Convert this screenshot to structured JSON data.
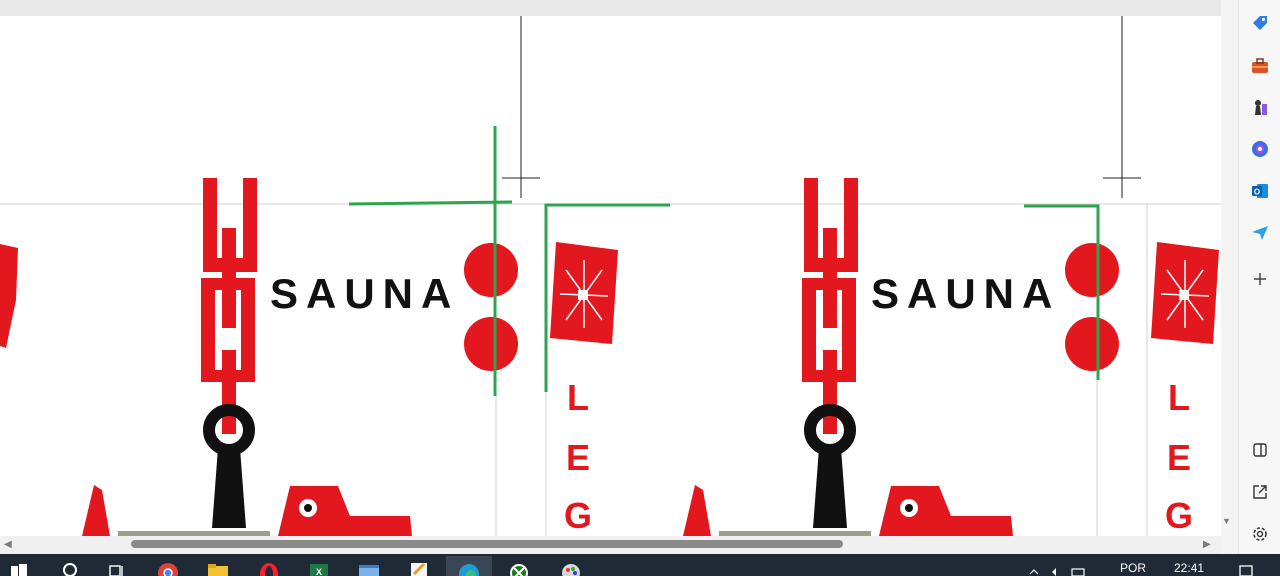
{
  "document": {
    "pages": [
      {
        "title": "SAUNA",
        "side_letters": [
          "L",
          "E",
          "G"
        ]
      },
      {
        "title": "SAUNA",
        "side_letters": [
          "L",
          "E",
          "G"
        ]
      }
    ]
  },
  "scrollbar": {
    "left_arrow": "◀",
    "right_arrow": "▶",
    "down_arrow": "▼"
  },
  "sidebar": {
    "items": [
      {
        "icon": "tag-icon"
      },
      {
        "icon": "briefcase-icon"
      },
      {
        "icon": "chess-icon"
      },
      {
        "icon": "copilot-icon"
      },
      {
        "icon": "outlook-icon"
      },
      {
        "icon": "send-icon"
      },
      {
        "icon": "plus-icon"
      },
      {
        "icon": "split-screen-icon"
      },
      {
        "icon": "open-external-icon"
      },
      {
        "icon": "gear-icon"
      }
    ]
  },
  "taskbar": {
    "language": "POR",
    "time": "22:41",
    "apps": [
      "windows",
      "search",
      "task-view",
      "chrome",
      "file-explorer",
      "opera",
      "excel",
      "photos",
      "paint",
      "edge",
      "xbox",
      "paint-3d"
    ]
  },
  "colors": {
    "brand_red": "#e3171e",
    "green_guide": "#2ea44f",
    "black": "#111111"
  }
}
